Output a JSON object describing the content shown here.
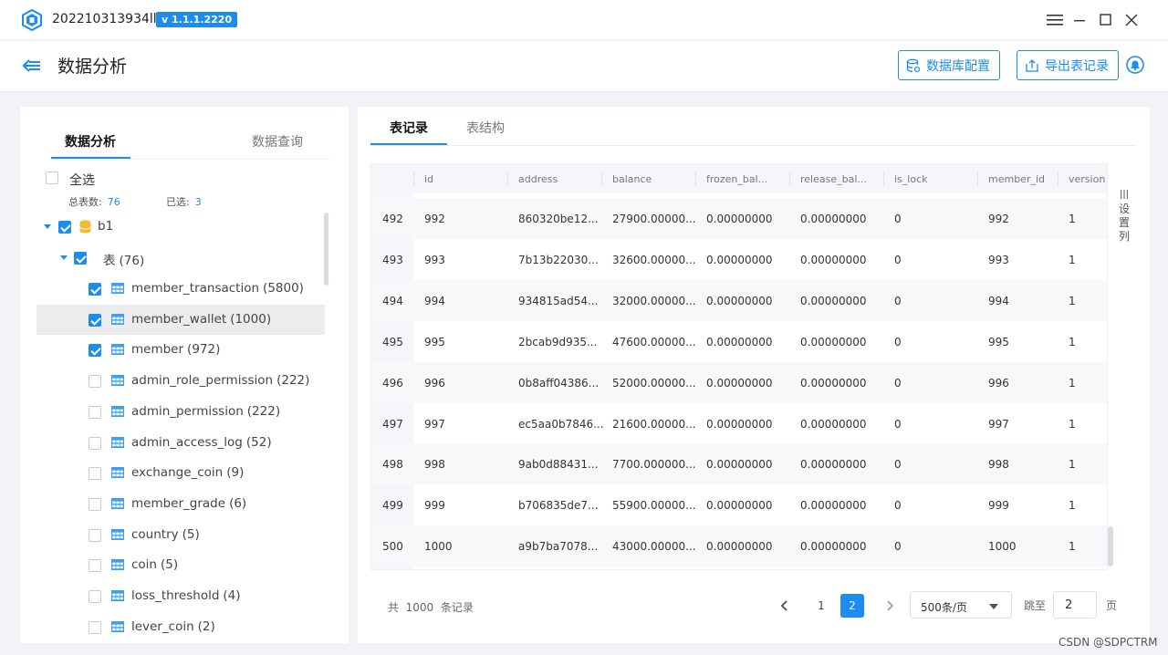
{
  "window": {
    "title": "202210313934lll2",
    "version": "v 1.1.1.2220"
  },
  "header": {
    "title": "数据分析",
    "db_config_label": "数据库配置",
    "export_label": "导出表记录"
  },
  "left": {
    "tabs": [
      "数据分析",
      "数据查询"
    ],
    "select_all": "全选",
    "total_label": "总表数:",
    "total_value": "76",
    "selected_label": "已选:",
    "selected_value": "3",
    "db_name": "b1",
    "table_group": "表",
    "table_group_count": "(76)",
    "tables": [
      {
        "name": "member_transaction",
        "count": "(5800)",
        "checked": true
      },
      {
        "name": "member_wallet",
        "count": "(1000)",
        "checked": true
      },
      {
        "name": "member",
        "count": "(972)",
        "checked": true
      },
      {
        "name": "admin_role_permission",
        "count": "(222)",
        "checked": false
      },
      {
        "name": "admin_permission",
        "count": "(222)",
        "checked": false
      },
      {
        "name": "admin_access_log",
        "count": "(52)",
        "checked": false
      },
      {
        "name": "exchange_coin",
        "count": "(9)",
        "checked": false
      },
      {
        "name": "member_grade",
        "count": "(6)",
        "checked": false
      },
      {
        "name": "country",
        "count": "(5)",
        "checked": false
      },
      {
        "name": "coin",
        "count": "(5)",
        "checked": false
      },
      {
        "name": "loss_threshold",
        "count": "(4)",
        "checked": false
      },
      {
        "name": "lever_coin",
        "count": "(2)",
        "checked": false
      }
    ]
  },
  "right": {
    "tabs": [
      "表记录",
      "表结构"
    ],
    "columns": [
      "id",
      "address",
      "balance",
      "frozen_bal...",
      "release_bal...",
      "is_lock",
      "member_id",
      "version"
    ],
    "settings_label": [
      "设",
      "置",
      "列"
    ],
    "rows": [
      [
        "492",
        "992",
        "860320be12...",
        "27900.00000...",
        "0.00000000",
        "0.00000000",
        "0",
        "992",
        "1"
      ],
      [
        "493",
        "993",
        "7b13b22030...",
        "32600.00000...",
        "0.00000000",
        "0.00000000",
        "0",
        "993",
        "1"
      ],
      [
        "494",
        "994",
        "934815ad54...",
        "32000.00000...",
        "0.00000000",
        "0.00000000",
        "0",
        "994",
        "1"
      ],
      [
        "495",
        "995",
        "2bcab9d935...",
        "47600.00000...",
        "0.00000000",
        "0.00000000",
        "0",
        "995",
        "1"
      ],
      [
        "496",
        "996",
        "0b8aff04386...",
        "52000.00000...",
        "0.00000000",
        "0.00000000",
        "0",
        "996",
        "1"
      ],
      [
        "497",
        "997",
        "ec5aa0b7846...",
        "21600.00000...",
        "0.00000000",
        "0.00000000",
        "0",
        "997",
        "1"
      ],
      [
        "498",
        "998",
        "9ab0d88431...",
        "7700.000000...",
        "0.00000000",
        "0.00000000",
        "0",
        "998",
        "1"
      ],
      [
        "499",
        "999",
        "b706835de7...",
        "55900.00000...",
        "0.00000000",
        "0.00000000",
        "0",
        "999",
        "1"
      ],
      [
        "500",
        "1000",
        "a9b7ba7078...",
        "43000.00000...",
        "0.00000000",
        "0.00000000",
        "0",
        "1000",
        "1"
      ]
    ],
    "footer": {
      "total_prefix": "共",
      "total_value": "1000",
      "total_suffix": "条记录",
      "pages": [
        "1",
        "2"
      ],
      "current_page": "2",
      "page_size": "500条/页",
      "goto_label": "跳至",
      "goto_value": "2",
      "page_unit": "页"
    }
  },
  "watermark": "CSDN @SDPCTRM",
  "colors": {
    "accent": "#1c8cf0",
    "selected_row": "#ececec"
  }
}
